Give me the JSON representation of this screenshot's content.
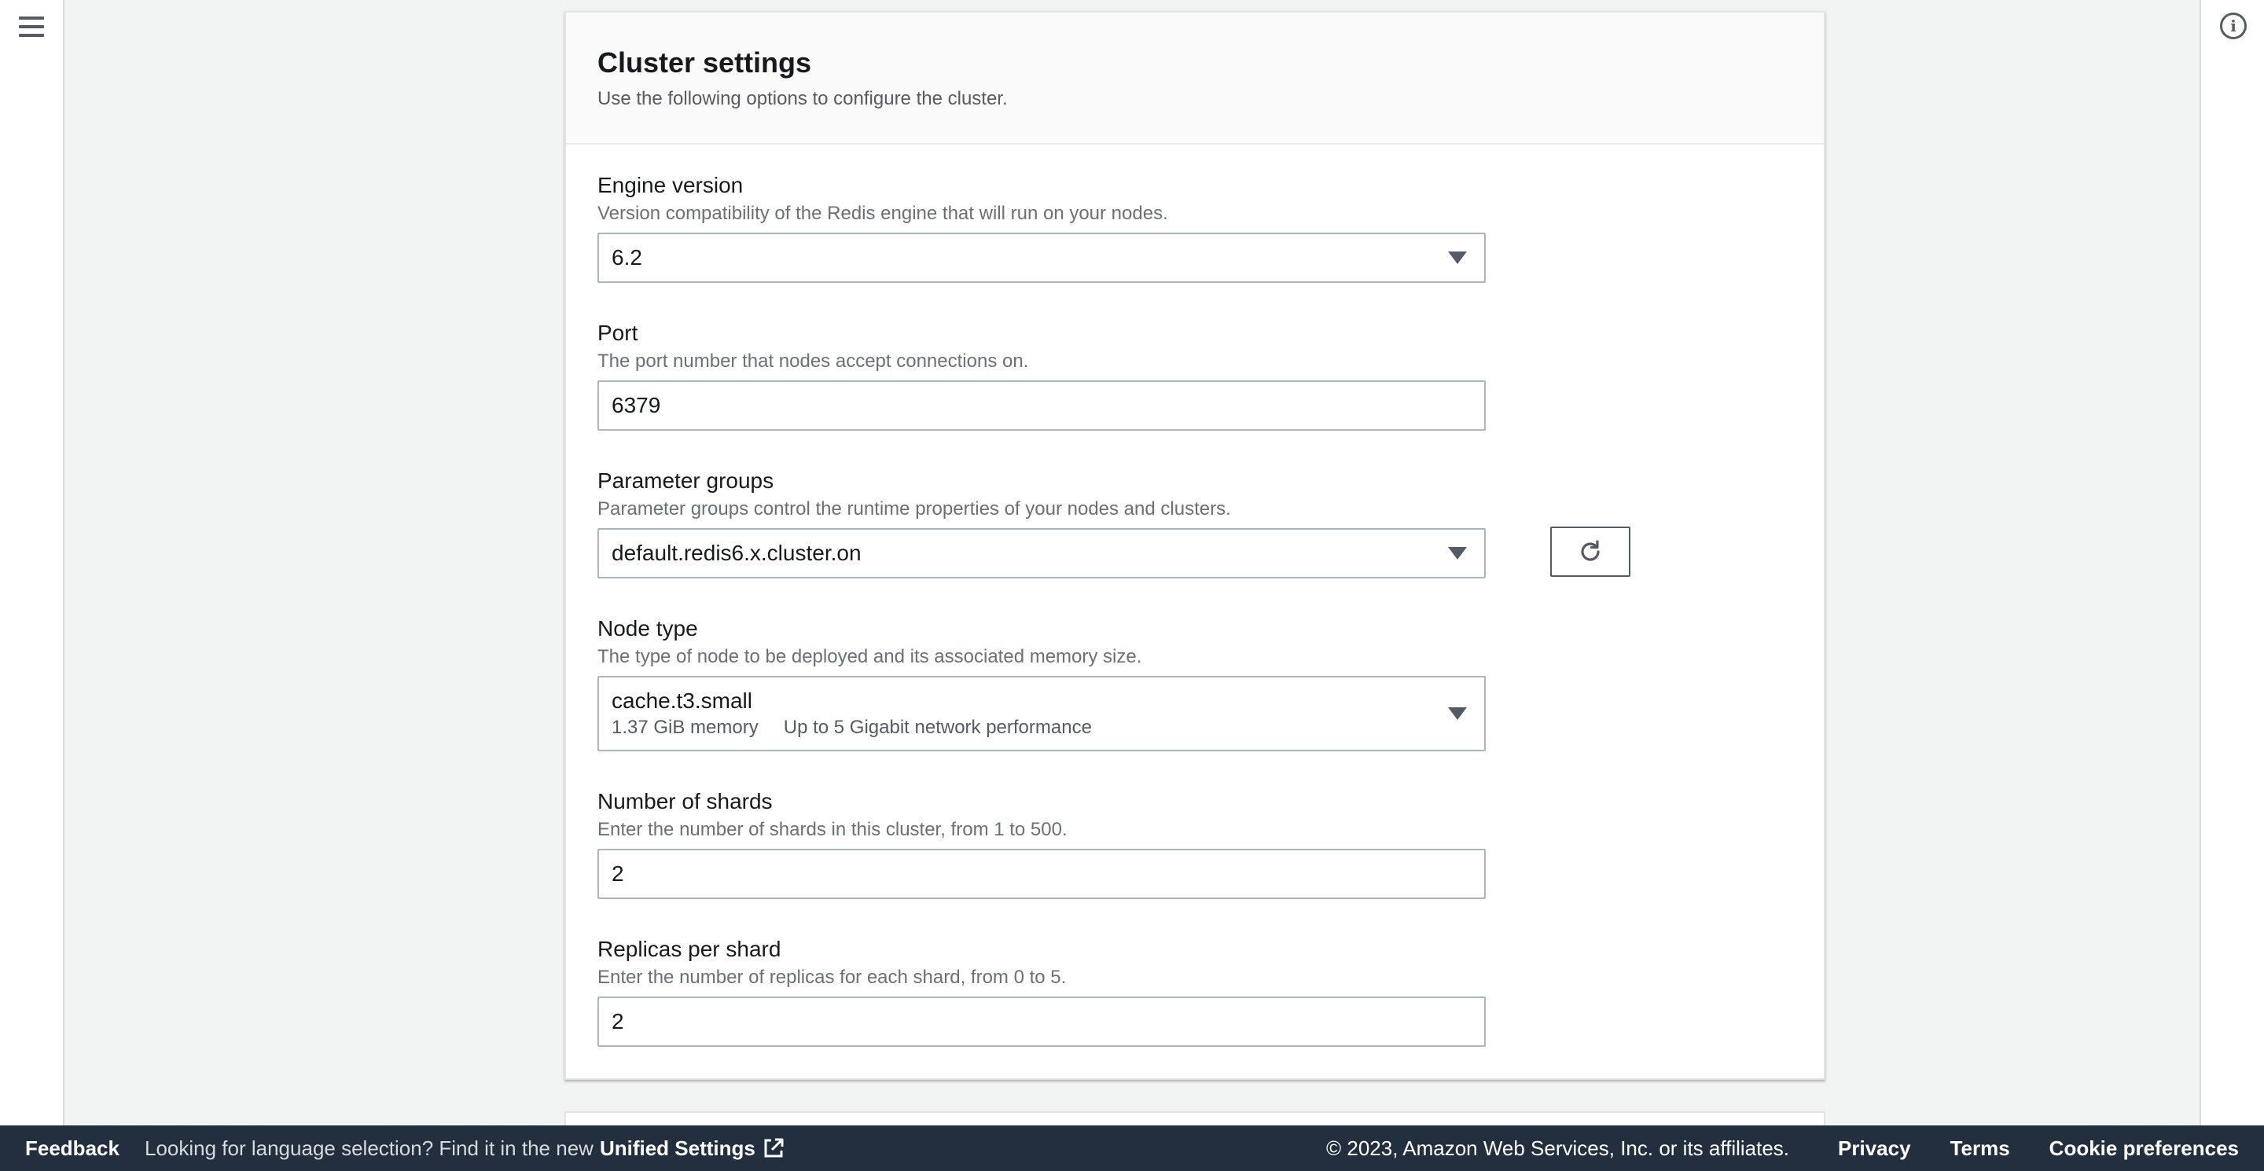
{
  "panel": {
    "title": "Cluster settings",
    "description": "Use the following options to configure the cluster."
  },
  "fields": {
    "engine_version": {
      "label": "Engine version",
      "description": "Version compatibility of the Redis engine that will run on your nodes.",
      "value": "6.2"
    },
    "port": {
      "label": "Port",
      "description": "The port number that nodes accept connections on.",
      "value": "6379"
    },
    "parameter_groups": {
      "label": "Parameter groups",
      "description": "Parameter groups control the runtime properties of your nodes and clusters.",
      "value": "default.redis6.x.cluster.on"
    },
    "node_type": {
      "label": "Node type",
      "description": "The type of node to be deployed and its associated memory size.",
      "value": "cache.t3.small",
      "memory": "1.37 GiB memory",
      "network": "Up to 5 Gigabit network performance"
    },
    "num_shards": {
      "label": "Number of shards",
      "description": "Enter the number of shards in this cluster, from 1 to 500.",
      "value": "2"
    },
    "replicas": {
      "label": "Replicas per shard",
      "description": "Enter the number of replicas for each shard, from 0 to 5.",
      "value": "2"
    }
  },
  "footer": {
    "feedback": "Feedback",
    "language_hint": "Looking for language selection? Find it in the new",
    "unified_settings": "Unified Settings",
    "copyright": "© 2023, Amazon Web Services, Inc. or its affiliates.",
    "privacy": "Privacy",
    "terms": "Terms",
    "cookie_preferences": "Cookie preferences"
  },
  "icons": {
    "menu": "hamburger-menu-icon",
    "info": "info-icon",
    "refresh": "refresh-icon",
    "external": "external-link-icon",
    "caret": "caret-down-icon"
  },
  "colors": {
    "footer_bg": "#232f3e",
    "page_bg": "#f2f3f3",
    "border": "#aab7b8"
  }
}
